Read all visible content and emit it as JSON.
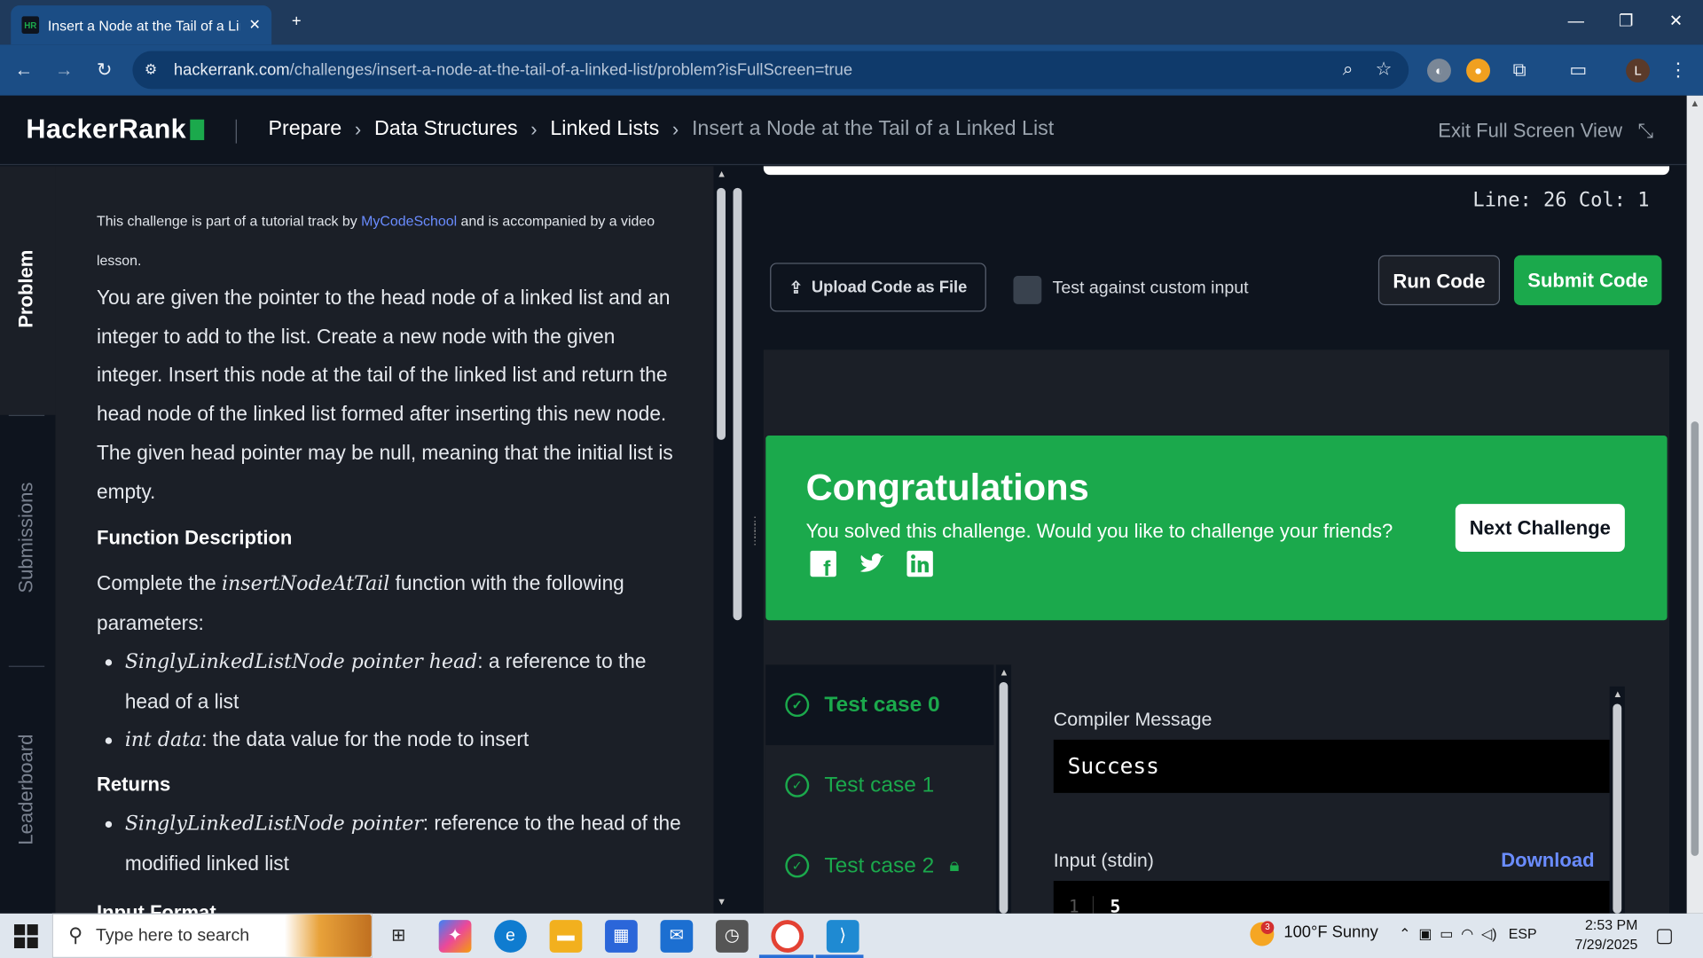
{
  "browser": {
    "tab_title": "Insert a Node at the Tail of a Lin",
    "favicon_text": "HR",
    "url_host": "hackerrank.com",
    "url_path": "/challenges/insert-a-node-at-the-tail-of-a-linked-list/problem?isFullScreen=true",
    "profile_initial": "L"
  },
  "header": {
    "logo": "HackerRank",
    "breadcrumbs": [
      "Prepare",
      "Data Structures",
      "Linked Lists"
    ],
    "current": "Insert a Node at the Tail of a Linked List",
    "exit_fullscreen": "Exit Full Screen View"
  },
  "rail": {
    "tabs": [
      "Problem",
      "Submissions",
      "Leaderboard"
    ]
  },
  "problem": {
    "note_before": "This challenge is part of a tutorial track by ",
    "note_link": "MyCodeSchool",
    "note_after": " and is accompanied by a video lesson.",
    "description": "You are given the pointer to the head node of a linked list and an integer to add to the list. Create a new node with the given integer. Insert this node at the tail of the linked list and return the head node of the linked list formed after inserting this new node. The given head pointer may be null, meaning that the initial list is empty.",
    "function_heading": "Function Description",
    "function_pre": "Complete the ",
    "function_name": "insertNodeAtTail",
    "function_post": " function with the following parameters:",
    "params": [
      {
        "math": "SinglyLinkedListNode pointer head",
        "text": ": a reference to the head of a list"
      },
      {
        "math": "int data",
        "text": ": the data value for the node to insert"
      }
    ],
    "returns_heading": "Returns",
    "returns": [
      {
        "math": "SinglyLinkedListNode pointer",
        "text": ": reference to the head of the modified linked list"
      }
    ],
    "next_heading": "Input Format"
  },
  "editor": {
    "line_col": "Line: 26 Col: 1",
    "upload_label": "Upload Code as File",
    "custom_input_label": "Test against custom input",
    "run_label": "Run Code",
    "submit_label": "Submit Code"
  },
  "result": {
    "title": "Congratulations",
    "subtitle": "You solved this challenge. Would you like to challenge your friends?",
    "next_label": "Next Challenge",
    "test_cases": [
      "Test case 0",
      "Test case 1",
      "Test case 2"
    ],
    "compiler_label": "Compiler Message",
    "compiler_value": "Success",
    "stdin_label": "Input (stdin)",
    "download_label": "Download",
    "stdin_line_no": "1",
    "stdin_first": "5"
  },
  "taskbar": {
    "search_placeholder": "Type here to search",
    "weather": "100°F  Sunny",
    "weather_badge": "3",
    "lang": "ESP",
    "time": "2:53 PM",
    "date": "7/29/2025"
  },
  "colors": {
    "hr_green": "#1ba94c",
    "link_blue": "#6a8cff",
    "dark_bg": "#0e141e",
    "panel_bg": "#1b1f27"
  }
}
